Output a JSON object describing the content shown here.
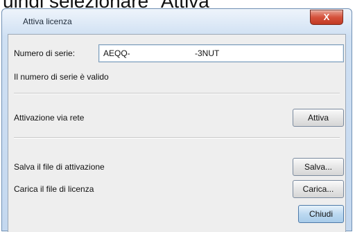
{
  "caption": "uindi selezionare \"Attiva\"",
  "window": {
    "title": "Attiva licenza",
    "close_glyph": "X"
  },
  "serial": {
    "label": "Numero di serie:",
    "value_start": "AEQQ-",
    "value_end": "-3NUT",
    "status": "Il numero di serie è valido"
  },
  "activation": {
    "label": "Attivazione via rete",
    "button": "Attiva"
  },
  "save": {
    "label": "Salva il file di attivazione",
    "button": "Salva..."
  },
  "load": {
    "label": "Carica il file di licenza",
    "button": "Carica..."
  },
  "close_button": "Chiudi"
}
